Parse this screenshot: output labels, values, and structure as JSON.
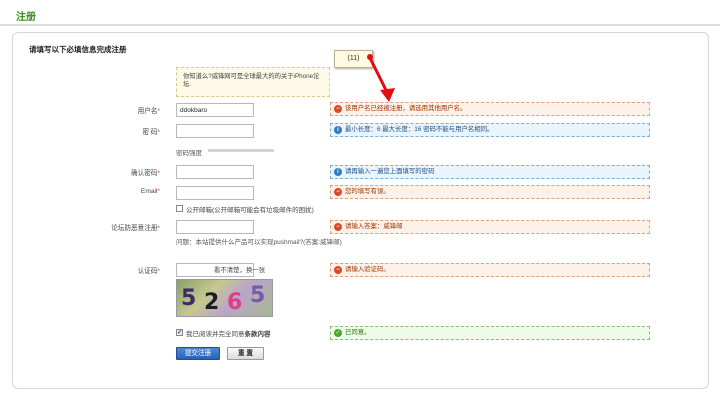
{
  "page": {
    "title": "注册"
  },
  "form": {
    "heading": "请填写以下必填信息完成注册",
    "tip": "你知道么?威锋网可是全球最大的的关于iPhone论坛.",
    "fields": {
      "username": {
        "label": "用户名",
        "value": "ddokbaro"
      },
      "password": {
        "label": "密 码",
        "value": ""
      },
      "strength_label": "密码强度",
      "confirm": {
        "label": "确认密码",
        "value": ""
      },
      "email": {
        "label": "Email",
        "value": ""
      },
      "public_email": "公开邮箱(公开邮箱可能会有垃圾邮件的困扰)",
      "anti_spam": {
        "label": "论坛防恶意注册",
        "value": ""
      },
      "anti_spam_hint": "问题：本站提供什么产品可以实现pushmail?(答案:威锋邮)",
      "captcha": {
        "label": "认证码",
        "refresh": "看不清楚，换一张",
        "chars": [
          "5",
          "2",
          "6",
          "5"
        ]
      },
      "agree": {
        "prefix": "我已阅读并完全同意",
        "terms": "条款内容"
      }
    },
    "buttons": {
      "submit": "提交注册",
      "reset": "重 置"
    }
  },
  "messages": {
    "username": "该用户名已经被注册，请选用其他用户名。",
    "password": "最小长度：6 最大长度：16 密码不能与用户名相同。",
    "confirm": "请再输入一遍您上面填写的密码",
    "email": "您的填写有误。",
    "anti_spam": "请输入答案：威锋邮",
    "captcha": "请输入验证码。",
    "agree": "已同意。"
  },
  "annotation": {
    "label": "(11)",
    "arrow_color": "#e01010"
  },
  "colors": {
    "accent": "#3a8a1a",
    "submit": "#2763b5",
    "error": "#d94a2b",
    "info": "#2f7cc2",
    "ok": "#4aa52e"
  }
}
